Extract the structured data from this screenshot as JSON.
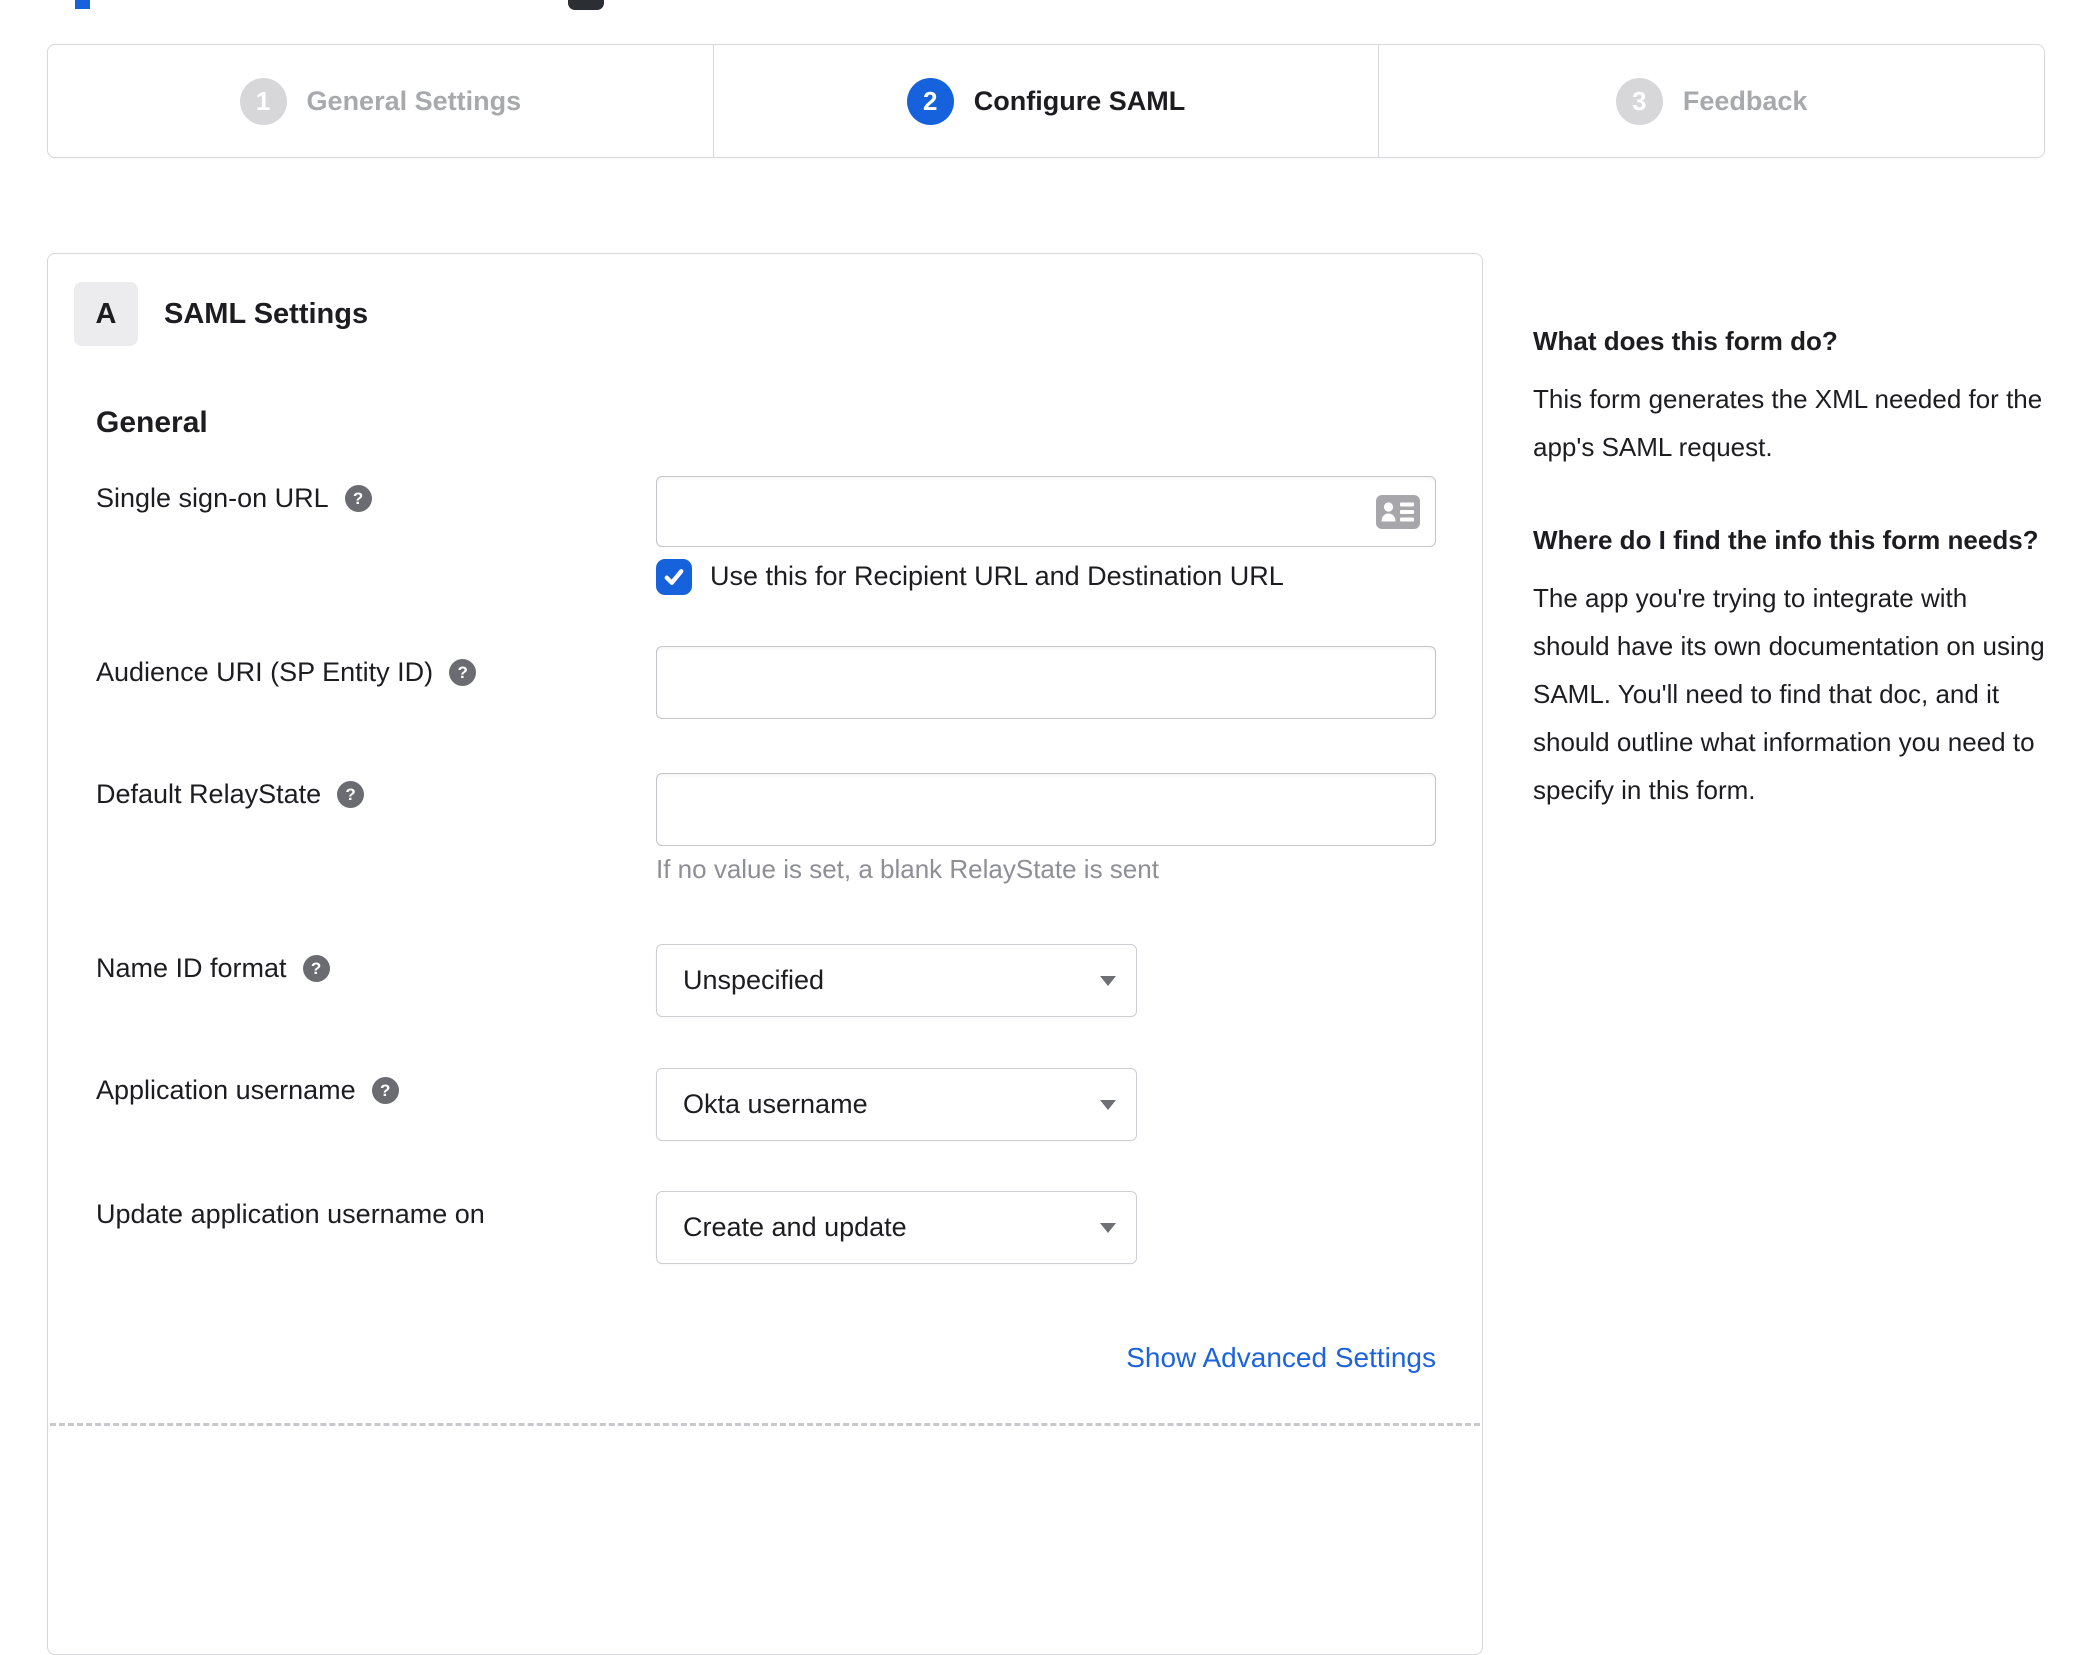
{
  "stepper": {
    "steps": [
      {
        "num": "1",
        "label": "General Settings",
        "state": "inactive"
      },
      {
        "num": "2",
        "label": "Configure SAML",
        "state": "active"
      },
      {
        "num": "3",
        "label": "Feedback",
        "state": "inactive"
      }
    ]
  },
  "panel": {
    "section_letter": "A",
    "section_title": "SAML Settings",
    "group_title": "General",
    "fields": {
      "sso_url": {
        "label": "Single sign-on URL",
        "value": "",
        "checkbox_checked": true,
        "checkbox_label": "Use this for Recipient URL and Destination URL"
      },
      "audience_uri": {
        "label": "Audience URI (SP Entity ID)",
        "value": ""
      },
      "relay_state": {
        "label": "Default RelayState",
        "value": "",
        "hint": "If no value is set, a blank RelayState is sent"
      },
      "name_id": {
        "label": "Name ID format",
        "value": "Unspecified"
      },
      "app_username": {
        "label": "Application username",
        "value": "Okta username"
      },
      "update_username": {
        "label": "Update application username on",
        "value": "Create and update"
      }
    },
    "advanced_link": "Show Advanced Settings"
  },
  "sidebar": {
    "blocks": [
      {
        "heading": "What does this form do?",
        "body": "This form generates the XML needed for the app's SAML request."
      },
      {
        "heading": "Where do I find the info this form needs?",
        "body": "The app you're trying to integrate with should have its own documentation on using SAML. You'll need to find that doc, and it should outline what information you need to specify in this form."
      }
    ]
  },
  "icons": {
    "help_glyph": "?"
  },
  "colors": {
    "accent_blue": "#1662dd",
    "inactive_gray": "#a7a9ac",
    "border_gray": "#d8d8dc"
  }
}
